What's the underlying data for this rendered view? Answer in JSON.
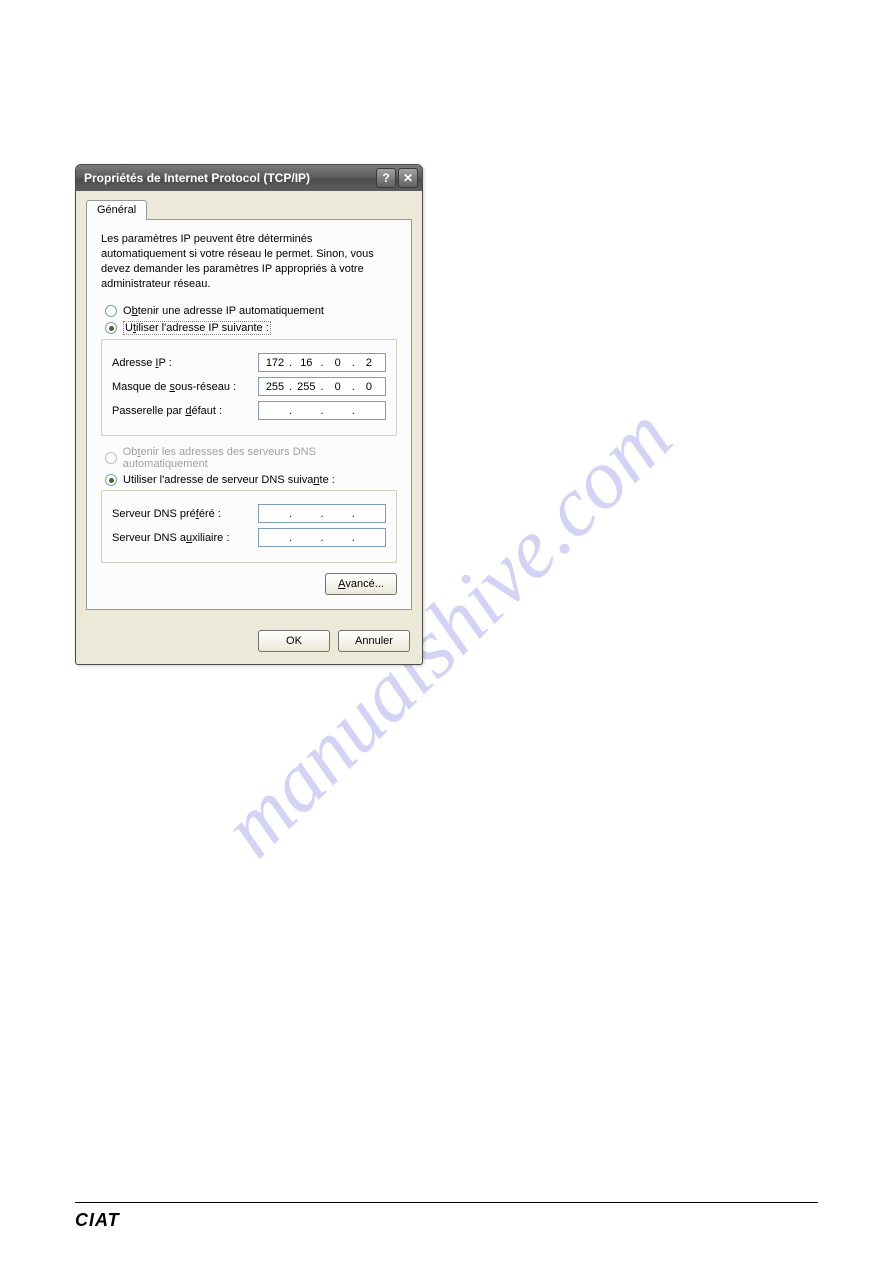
{
  "watermark": "manualshive.com",
  "dialog": {
    "title": "Propriétés de Internet Protocol (TCP/IP)",
    "help_btn": "?",
    "close_btn": "✕",
    "tab_general": "Général",
    "description": "Les paramètres IP peuvent être déterminés automatiquement si votre réseau le permet. Sinon, vous devez demander les paramètres IP appropriés à votre administrateur réseau.",
    "radio_auto_ip_pre": "O",
    "radio_auto_ip_und": "b",
    "radio_auto_ip_post": "tenir une adresse IP automatiquement",
    "radio_use_ip_pre": "U",
    "radio_use_ip_und": "t",
    "radio_use_ip_post": "iliser l'adresse IP suivante :",
    "ip": {
      "label_pre": "Adresse ",
      "label_und": "I",
      "label_post": "P :",
      "o1": "172",
      "o2": "16",
      "o3": "0",
      "o4": "2"
    },
    "mask": {
      "label_pre": "Masque de ",
      "label_und": "s",
      "label_post": "ous-réseau :",
      "o1": "255",
      "o2": "255",
      "o3": "0",
      "o4": "0"
    },
    "gateway": {
      "label_pre": "Passerelle par ",
      "label_und": "d",
      "label_post": "éfaut :",
      "o1": "",
      "o2": "",
      "o3": "",
      "o4": ""
    },
    "radio_auto_dns_pre": "Ob",
    "radio_auto_dns_und": "t",
    "radio_auto_dns_post": "enir les adresses des serveurs DNS automatiquement",
    "radio_use_dns_pre": "Utiliser l'adresse de serveur DNS suiva",
    "radio_use_dns_und": "n",
    "radio_use_dns_post": "te :",
    "dns1": {
      "label_pre": "Serveur DNS pré",
      "label_und": "f",
      "label_post": "éré :",
      "o1": "",
      "o2": "",
      "o3": "",
      "o4": ""
    },
    "dns2": {
      "label_pre": "Serveur DNS a",
      "label_und": "u",
      "label_post": "xiliaire :",
      "o1": "",
      "o2": "",
      "o3": "",
      "o4": ""
    },
    "advanced_und": "A",
    "advanced_post": "vancé...",
    "ok": "OK",
    "cancel": "Annuler"
  },
  "footer_logo": "CIAT"
}
